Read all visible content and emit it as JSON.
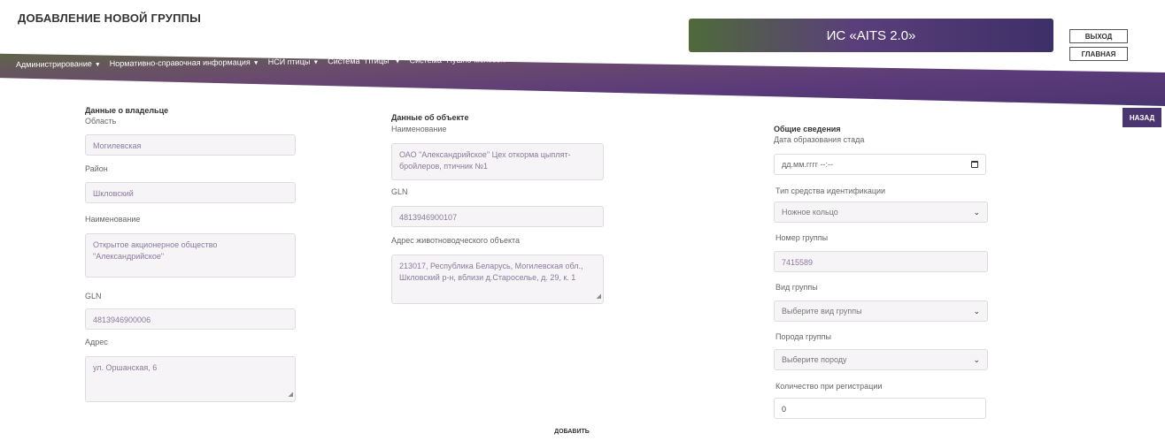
{
  "page_title": "ДОБАВЛЕНИЕ НОВОЙ ГРУППЫ",
  "banner_title": "ИС «AITS 2.0»",
  "buttons": {
    "exit": "ВЫХОД",
    "main": "ГЛАВНАЯ",
    "back": "НАЗАД",
    "add": "ДОБАВИТЬ"
  },
  "nav": [
    {
      "label": "Администрирование"
    },
    {
      "label": "Нормативно-справочная информация"
    },
    {
      "label": "НСИ птицы"
    },
    {
      "label": "Система \"Птицы\""
    },
    {
      "label": "Система \"Пушно-меховые\""
    }
  ],
  "owner": {
    "title": "Данные о владельце",
    "region_label": "Область",
    "region_value": "Могилевская",
    "district_label": "Район",
    "district_value": "Шкловский",
    "name_label": "Наименование",
    "name_value": "Открытое акционерное общество \"Александрийское\"",
    "gln_label": "GLN",
    "gln_value": "4813946900006",
    "address_label": "Адрес",
    "address_value": "ул. Оршанская, 6"
  },
  "object": {
    "title": "Данные об объекте",
    "name_label": "Наименование",
    "name_value": "ОАО \"Александрийское\" Цех откорма цыплят-бройлеров, птичник №1",
    "gln_label": "GLN",
    "gln_value": "4813946900107",
    "address_label": "Адрес животноводческого объекта",
    "address_value": "213017, Республика Беларусь, Могилевская обл., Шкловский р-н, вблизи д.Староселье, д. 29, к. 1"
  },
  "general": {
    "title": "Общие сведения",
    "date_label": "Дата образования стада",
    "date_placeholder": "дд.мм.гггг --:--",
    "id_type_label": "Тип средства идентификации",
    "id_type_value": "Ножное кольцо",
    "group_number_label": "Номер группы",
    "group_number_value": "7415589",
    "group_kind_label": "Вид группы",
    "group_kind_value": "Выберите вид группы",
    "breed_label": "Порода группы",
    "breed_value": "Выберите породу",
    "count_label": "Количество при регистрации",
    "count_value": "0"
  },
  "colors": {
    "accent": "#4a3570",
    "nav_green": "#5c6e3b"
  }
}
